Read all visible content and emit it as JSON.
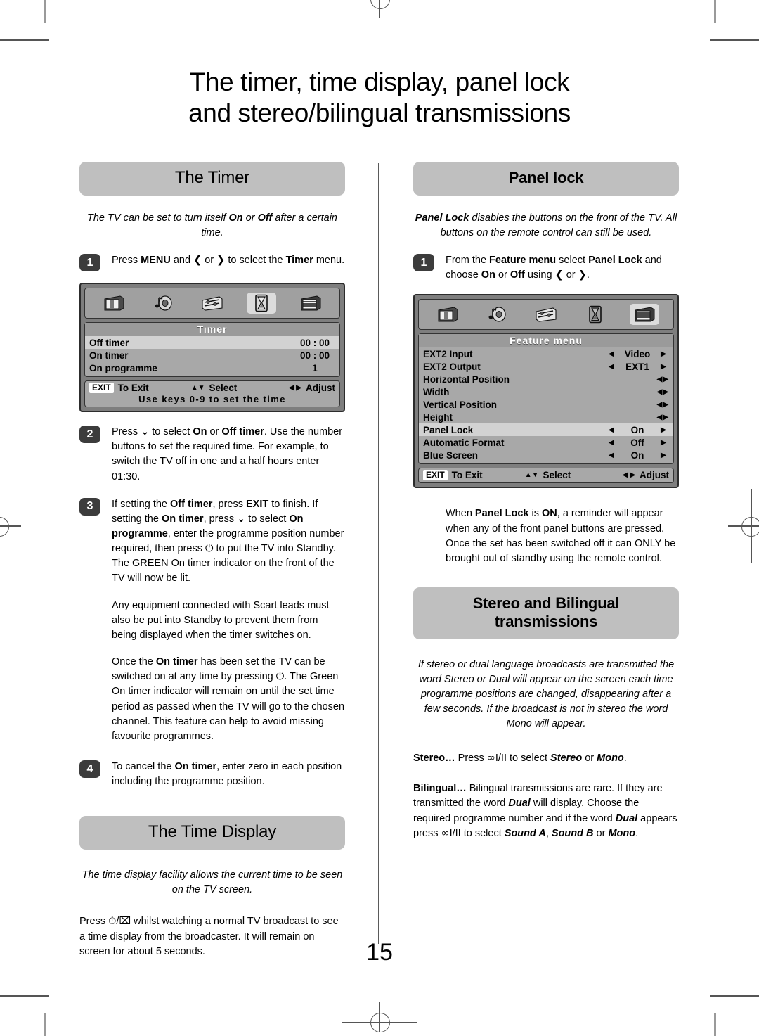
{
  "page": {
    "title_line1": "The timer, time display, panel lock",
    "title_line2": "and stereo/bilingual transmissions",
    "number": "15"
  },
  "colors": {
    "section_bar": "#bfbfbf",
    "badge": "#3c3c3c",
    "osd_bg": "#a8a8a8",
    "osd_frame": "#7e7e7e",
    "osd_highlight": "#d2d2d2",
    "text": "#000000"
  },
  "left": {
    "timer_section": {
      "header": "The Timer",
      "intro_a": "The TV can be set to turn itself ",
      "intro_b1": "On",
      "intro_mid": " or ",
      "intro_b2": "Off",
      "intro_c": " after a certain time.",
      "step1": {
        "badge": "1",
        "t1": "Press ",
        "b1": "MENU",
        "t2": " and ",
        "g1": "❮",
        "t3": " or ",
        "g2": "❯",
        "t4": " to select the ",
        "b2": "Timer",
        "t5": " menu."
      },
      "osd": {
        "icons": [
          "picture-icon",
          "sound-icon",
          "setup-icon",
          "timer-icon",
          "feature-icon"
        ],
        "selected_icon_index": 3,
        "title": "Timer",
        "rows": [
          {
            "label": "Off timer",
            "value": "00 : 00",
            "highlight": true
          },
          {
            "label": "On timer",
            "value": "00 : 00",
            "highlight": false
          },
          {
            "label": "On programme",
            "value": "1",
            "highlight": false
          }
        ],
        "footer": {
          "exit_chip": "EXIT",
          "exit_label": "To Exit",
          "select_arrows": "▲▼",
          "select_label": "Select",
          "adjust_arrows": "◀ ▶",
          "adjust_label": "Adjust",
          "sub": "Use keys 0-9 to set the time"
        }
      },
      "step2": {
        "badge": "2",
        "t1": "Press ",
        "g1": "⌄",
        "t2": " to select ",
        "b1": "On",
        "t3": " or ",
        "b2": "Off timer",
        "t4": ". Use the number buttons to set the required time. For example, to switch the TV off in one and a half hours enter 01:30."
      },
      "step3": {
        "badge": "3",
        "t1": "If setting the ",
        "b1": "Off timer",
        "t2": ", press ",
        "b2": "EXIT",
        "t3": " to finish. If setting the ",
        "b3": "On timer",
        "t4": ", press ",
        "g1": "⌄",
        "t5": " to select ",
        "b4": "On programme",
        "t6": ", enter the programme position number required, then press ",
        "g2": "⏻",
        "t7": " to put the TV into Standby. The GREEN On timer indicator on the front of the TV will now be lit."
      },
      "para1": "Any equipment connected with Scart leads must also be put into Standby to prevent them from being displayed when the timer switches on.",
      "para2": {
        "t1": "Once the ",
        "b1": "On timer",
        "t2": " has been set the TV can be switched on at any time by pressing ",
        "g1": "⏻",
        "t3": ". The Green On timer indicator will remain on until the set time period as passed when the TV will go to the chosen channel. This feature can help to avoid missing favourite programmes."
      },
      "step4": {
        "badge": "4",
        "t1": "To cancel the ",
        "b1": "On timer",
        "t2": ", enter zero in each position including the programme position."
      }
    },
    "time_display_section": {
      "header": "The Time Display",
      "intro": "The time display facility allows the current time to be seen on the TV screen.",
      "body": {
        "t1": "Press ",
        "g1": "⏱",
        "t2": "/",
        "g2": "⌧",
        "t3": " whilst watching a normal TV broadcast to see a time display from the broadcaster. It will remain on screen for about 5 seconds."
      }
    }
  },
  "right": {
    "panel_lock_section": {
      "header": "Panel lock",
      "intro_b": "Panel Lock",
      "intro_t1": " disables the buttons on the front of the TV. All buttons on the remote control can still be used.",
      "step1": {
        "badge": "1",
        "t1": "From the ",
        "b1": "Feature menu",
        "t2": " select ",
        "b2": "Panel Lock",
        "t3": " and choose ",
        "b3": "On",
        "t4": " or ",
        "b4": "Off",
        "t5": " using ",
        "g1": "❮",
        "t6": " or ",
        "g2": "❯",
        "t7": "."
      },
      "osd": {
        "icons": [
          "picture-icon",
          "sound-icon",
          "setup-icon",
          "timer-icon",
          "feature-icon"
        ],
        "selected_icon_index": 4,
        "title": "Feature menu",
        "rows": [
          {
            "label": "EXT2 Input",
            "value": "Video",
            "arrows": "both",
            "highlight": false
          },
          {
            "label": "EXT2 Output",
            "value": "EXT1",
            "arrows": "both",
            "highlight": false
          },
          {
            "label": "Horizontal Position",
            "value": "",
            "arrows": "pair",
            "highlight": false
          },
          {
            "label": "Width",
            "value": "",
            "arrows": "pair",
            "highlight": false
          },
          {
            "label": "Vertical Position",
            "value": "",
            "arrows": "pair",
            "highlight": false
          },
          {
            "label": "Height",
            "value": "",
            "arrows": "pair",
            "highlight": false
          },
          {
            "label": "Panel Lock",
            "value": "On",
            "arrows": "both",
            "highlight": true
          },
          {
            "label": "Automatic Format",
            "value": "Off",
            "arrows": "both",
            "highlight": false
          },
          {
            "label": "Blue Screen",
            "value": "On",
            "arrows": "both",
            "highlight": false
          }
        ],
        "footer": {
          "exit_chip": "EXIT",
          "exit_label": "To Exit",
          "select_arrows": "▲▼",
          "select_label": "Select",
          "adjust_arrows": "◀ ▶",
          "adjust_label": "Adjust"
        }
      },
      "note": {
        "t1": "When ",
        "b1": "Panel Lock",
        "t2": " is ",
        "b2": "ON",
        "t3": ", a reminder will appear when any of the front panel buttons are pressed. Once the set has been switched off it can ONLY be brought out of standby using the remote control."
      }
    },
    "stereo_section": {
      "header": "Stereo and Bilingual transmissions",
      "intro": "If stereo or dual language broadcasts are transmitted the word Stereo or Dual will appear on the screen each time programme positions are changed, disappearing after a few seconds. If the broadcast is not in stereo the word Mono will appear.",
      "stereo": {
        "b1": "Stereo…",
        "t1": " Press ",
        "g1": "∞",
        "g2": "I/II",
        "t2": " to select ",
        "i1": "Stereo",
        "t3": " or ",
        "i2": "Mono",
        "t4": "."
      },
      "bilingual": {
        "b1": "Bilingual…",
        "t1": " Bilingual transmissions are rare. If they are transmitted the word ",
        "i1": "Dual",
        "t2": " will display. Choose the required programme number and if the word ",
        "i2": "Dual",
        "t3": " appears press ",
        "g1": "∞",
        "g2": "I/II",
        "t4": " to select ",
        "i3": "Sound A",
        "t5": ", ",
        "i4": "Sound B",
        "t6": " or ",
        "i5": "Mono",
        "t7": "."
      }
    }
  }
}
